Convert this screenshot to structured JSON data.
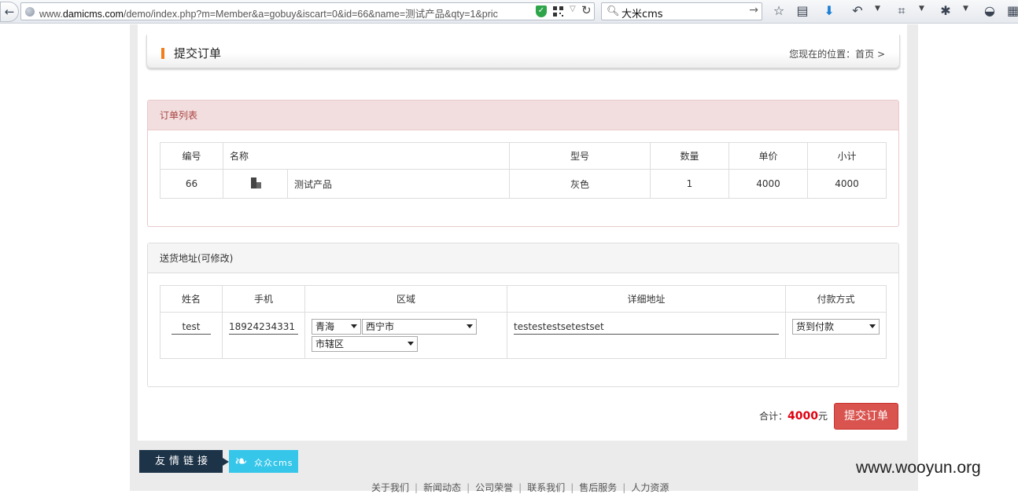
{
  "browser": {
    "url_prefix": "www.",
    "url_domain": "damicms.com",
    "url_rest": "/demo/index.php?m=Member&a=gobuy&iscart=0&id=66&name=测试产品&qty=1&pric",
    "search_query": "大米cms"
  },
  "header": {
    "title": "提交订单",
    "breadcrumb": "您现在的位置：首页 >"
  },
  "order_panel": {
    "title": "订单列表",
    "columns": [
      "编号",
      "名称",
      "型号",
      "数量",
      "单价",
      "小计"
    ],
    "row": {
      "id": "66",
      "name": "测试产品",
      "model": "灰色",
      "qty": "1",
      "price": "4000",
      "subtotal": "4000"
    }
  },
  "address_panel": {
    "title": "送货地址(可修改)",
    "columns": [
      "姓名",
      "手机",
      "区域",
      "详细地址",
      "付款方式"
    ],
    "name": "test",
    "phone": "18924234331",
    "province": "青海",
    "city": "西宁市",
    "district": "市辖区",
    "address": "testestestsetestset",
    "payment": "货到付款"
  },
  "summary": {
    "total_label": "合计：",
    "total_value": "4000",
    "currency": "元",
    "submit_label": "提交订单"
  },
  "footer": {
    "links_tag": "友情链接",
    "partner_logo_text": "众众cms",
    "links": [
      "关于我们",
      "新闻动态",
      "公司荣誉",
      "联系我们",
      "售后服务",
      "人力资源"
    ],
    "separator": "|"
  },
  "watermark": "www.wooyun.org"
}
